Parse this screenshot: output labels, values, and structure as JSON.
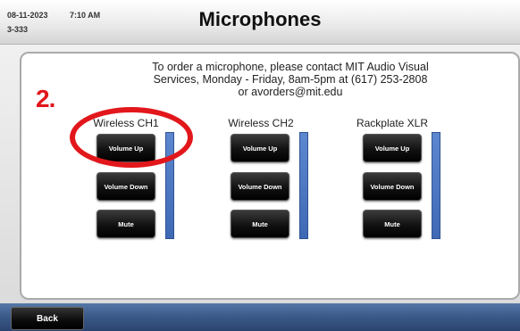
{
  "header": {
    "date": "08-11-2023",
    "time": "7:10 AM",
    "room": "3-333",
    "title": "Microphones"
  },
  "info": {
    "line1": "To order a microphone, please contact MIT Audio Visual",
    "line2": "Services, Monday - Friday, 8am-5pm at (617) 253-2808",
    "line3": "or avorders@mit.edu"
  },
  "annotation": {
    "step": "2."
  },
  "channels": [
    {
      "label": "Wireless CH1",
      "volume_up": "Volume Up",
      "volume_down": "Volume Down",
      "mute": "Mute"
    },
    {
      "label": "Wireless CH2",
      "volume_up": "Volume Up",
      "volume_down": "Volume Down",
      "mute": "Mute"
    },
    {
      "label": "Rackplate XLR",
      "volume_up": "Volume Up",
      "volume_down": "Volume Down",
      "mute": "Mute"
    }
  ],
  "footer": {
    "back_label": "Back"
  },
  "colors": {
    "annotation_red": "#e2171c",
    "meter_blue": "#4a74c2",
    "footer_blue": "#3c5b8a"
  }
}
